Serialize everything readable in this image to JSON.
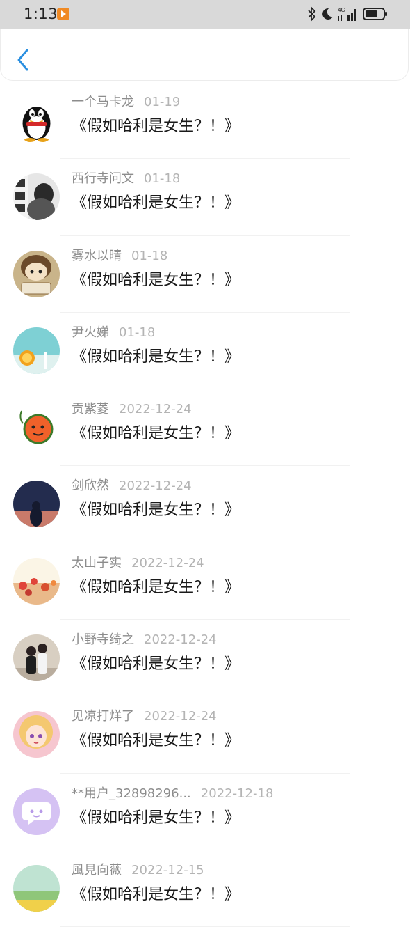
{
  "status_bar": {
    "time": "1:13",
    "icons": [
      "app-notification-icon",
      "bluetooth-icon",
      "moon-icon",
      "4g-signal-icon",
      "battery-icon"
    ]
  },
  "nav": {
    "back_icon": "chevron-left-icon",
    "accent": "#2a8fe0"
  },
  "comments": [
    {
      "user": "一个马卡龙",
      "date": "01-19",
      "text": "《假如哈利是女生？！》",
      "avatar": "qq-penguin"
    },
    {
      "user": "西行寺问文",
      "date": "01-18",
      "text": "《假如哈利是女生？！》",
      "avatar": "bw-photo"
    },
    {
      "user": "雾水以晴",
      "date": "01-18",
      "text": "《假如哈利是女生？！》",
      "avatar": "cartoon-doll"
    },
    {
      "user": "尹火娣",
      "date": "01-18",
      "text": "《假如哈利是女生？！》",
      "avatar": "orange-slice"
    },
    {
      "user": "贡紫菱",
      "date": "2022-12-24",
      "text": "《假如哈利是女生？！》",
      "avatar": "cartoon-orange"
    },
    {
      "user": "剑欣然",
      "date": "2022-12-24",
      "text": "《假如哈利是女生？！》",
      "avatar": "night-sky"
    },
    {
      "user": "太山子实",
      "date": "2022-12-24",
      "text": "《假如哈利是女生？！》",
      "avatar": "flowers"
    },
    {
      "user": "小野寺绮之",
      "date": "2022-12-24",
      "text": "《假如哈利是女生？！》",
      "avatar": "couple-photo"
    },
    {
      "user": "见凉打烊了",
      "date": "2022-12-24",
      "text": "《假如哈利是女生？！》",
      "avatar": "anime-girl"
    },
    {
      "user": "**用户_32898296...",
      "date": "2022-12-18",
      "text": "《假如哈利是女生？！》",
      "avatar": "default-chat"
    },
    {
      "user": "風見向薇",
      "date": "2022-12-15",
      "text": "《假如哈利是女生？！》",
      "avatar": "landscape"
    }
  ]
}
